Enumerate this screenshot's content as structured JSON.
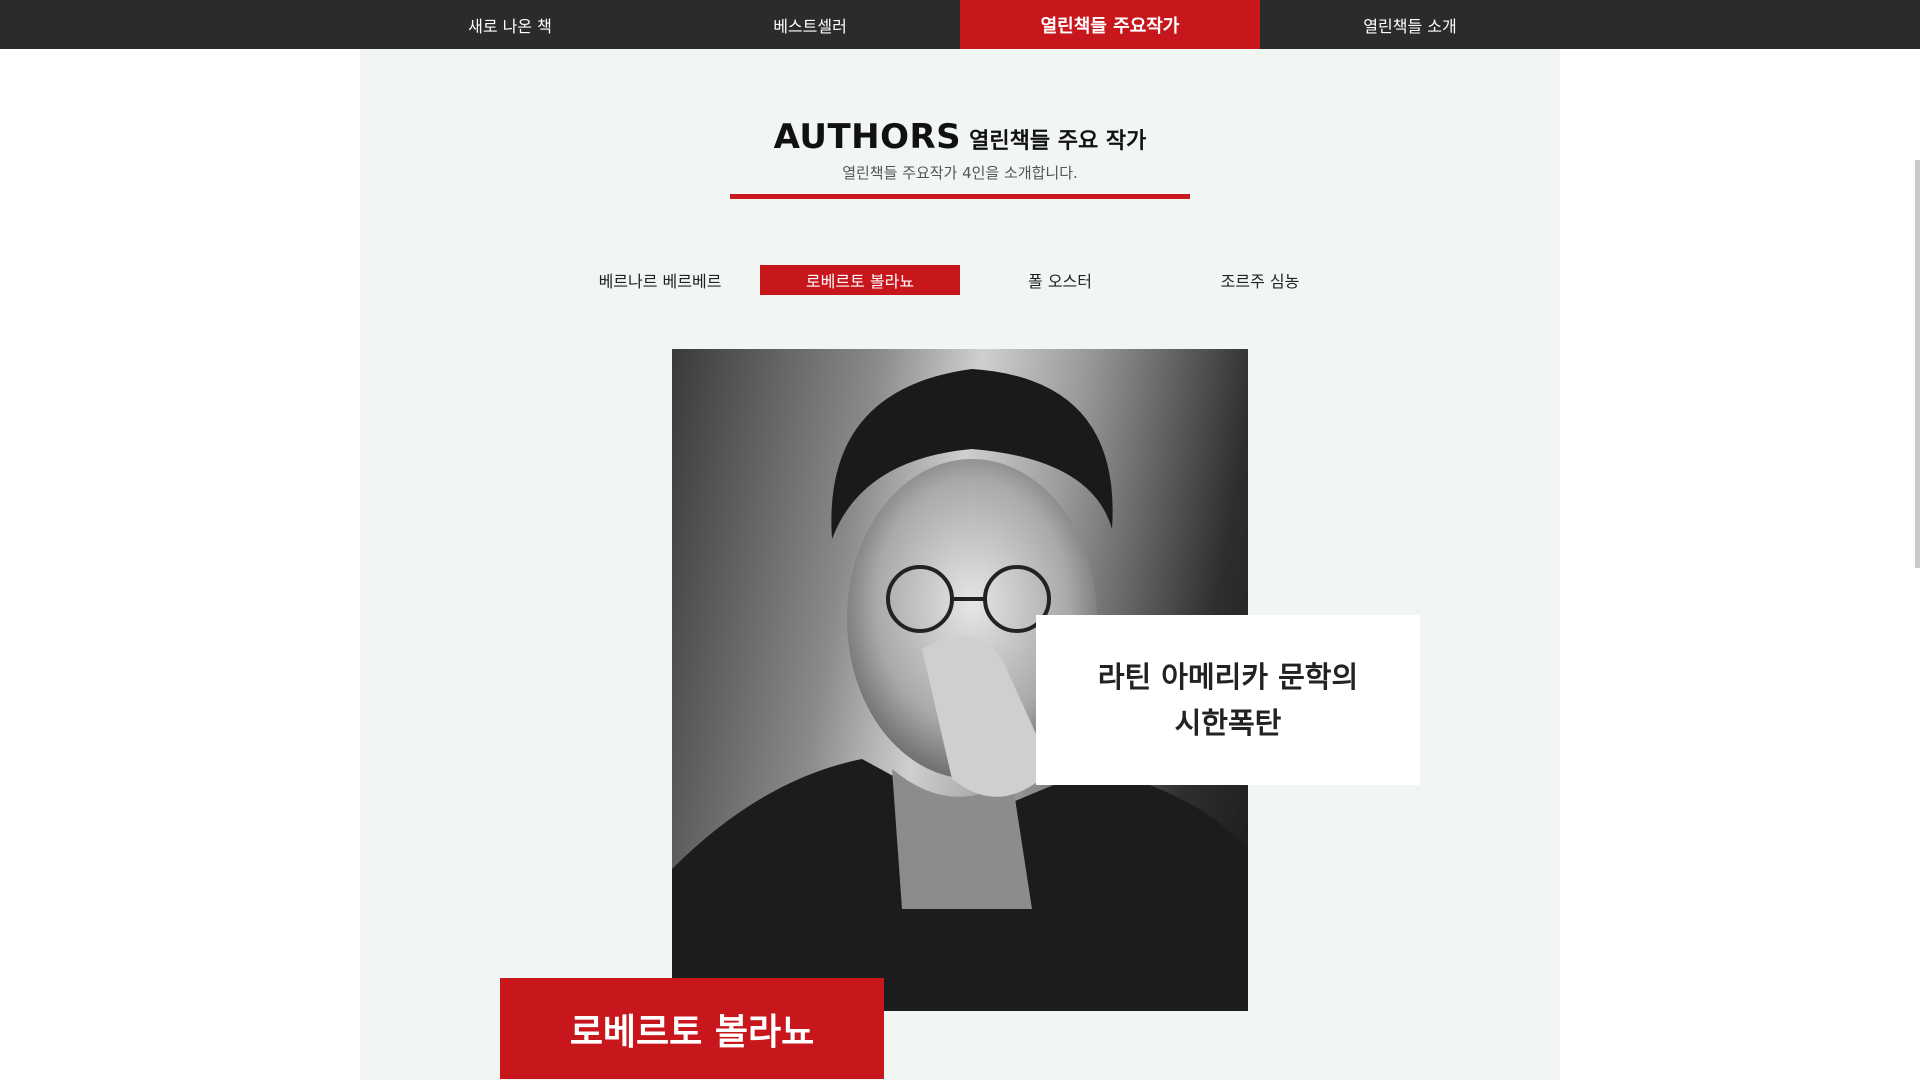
{
  "nav": {
    "items": [
      "새로 나온 책",
      "베스트셀러",
      "열린책들 주요작가",
      "열린책들 소개"
    ],
    "active_index": 2
  },
  "header": {
    "title_en": "AUTHORS",
    "title_ko": "열린책들 주요 작가",
    "subtitle": "열린책들 주요작가 4인을 소개합니다."
  },
  "tabs": {
    "items": [
      "베르나르 베르베르",
      "로베르토 볼라뇨",
      "폴 오스터",
      "조르주 심농"
    ],
    "active_index": 1
  },
  "feature": {
    "quote_line1": "라틴 아메리카 문학의",
    "quote_line2": "시한폭탄",
    "author_name": "로베르토 볼라뇨"
  },
  "colors": {
    "accent": "#c8161d",
    "nav_bg": "#2b2b2b",
    "panel_bg": "#f2f6f2"
  }
}
